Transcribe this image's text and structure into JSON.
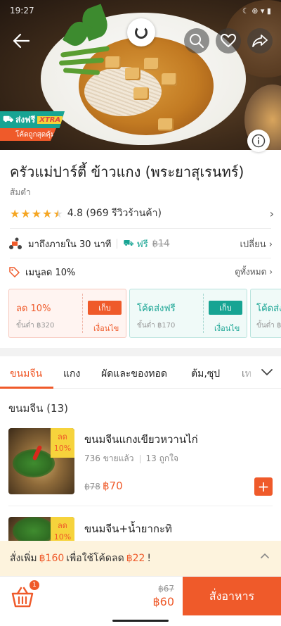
{
  "status_bar": {
    "time": "19:27",
    "right_text": "☾ ⊕ ▾ ▮"
  },
  "hero": {
    "badge": {
      "label": "ส่งฟรี",
      "xtra": "XTRA",
      "sub": "โค้ดถูกสุดคุ้ม"
    },
    "icons": [
      "back-arrow-icon",
      "loading-spinner-icon",
      "search-icon",
      "heart-icon",
      "share-icon",
      "info-icon"
    ]
  },
  "restaurant": {
    "name": "ครัวแม่ปาร์ตี้ ข้าวแกง (พระยาสุเรนทร์)",
    "cuisine": "ส้มตำ",
    "rating": 4.8,
    "rating_text": "4.8 (969 รีวิวร้านค้า)",
    "stars_filled": 4.5
  },
  "delivery": {
    "eta": "มาถึงภายใน 30 นาที",
    "fee_label": "ฟรี",
    "fee_old": "฿14",
    "change": "เปลี่ยน"
  },
  "promo": {
    "label": "เมนูลด 10%",
    "see_all": "ดูทั้งหมด"
  },
  "vouchers": [
    {
      "title": "ลด 10%",
      "min": "ขั้นต่ำ ฿320",
      "button": "เก็บ",
      "cond": "เงื่อนไข",
      "theme": "orange"
    },
    {
      "title": "โค้ดส่งฟรี",
      "min": "ขั้นต่ำ ฿170",
      "button": "เก็บ",
      "cond": "เงื่อนไข",
      "theme": "green"
    },
    {
      "title": "โค้ดส่ง",
      "min": "ขั้นต่ำ ฿",
      "theme": "green"
    }
  ],
  "tabs": [
    {
      "label": "ขนมจีน",
      "active": true
    },
    {
      "label": "แกง",
      "active": false
    },
    {
      "label": "ผัดและของทอด",
      "active": false
    },
    {
      "label": "ต้ม,ซุป",
      "active": false
    },
    {
      "label": "เท",
      "active": false
    }
  ],
  "section": {
    "title": "ขนมจีน (13)"
  },
  "menu_items": [
    {
      "name": "ขนมจีนแกงเขียวหวานไก่",
      "sold": "736 ขายแล้ว",
      "likes": "13 ถูกใจ",
      "price_old": "฿78",
      "price_new": "฿70",
      "discount": [
        "ลด",
        "10%"
      ],
      "add": "+"
    },
    {
      "name": "ขนมจีน+น้ำยากะทิ",
      "discount": [
        "ลด",
        "10%"
      ]
    }
  ],
  "spend_banner": {
    "prefix": "สั่งเพิ่ม",
    "amount": "฿160",
    "middle": "เพื่อใช้โค้ดลด",
    "discount": "฿22",
    "suffix": "!"
  },
  "bottom_bar": {
    "cart_count": "1",
    "total_old": "฿67",
    "total_new": "฿60",
    "order_button": "สั่งอาหาร"
  },
  "colors": {
    "accent": "#ef5a2a",
    "green": "#17a493",
    "star": "#f5a623",
    "banner": "#fdf3dd"
  }
}
